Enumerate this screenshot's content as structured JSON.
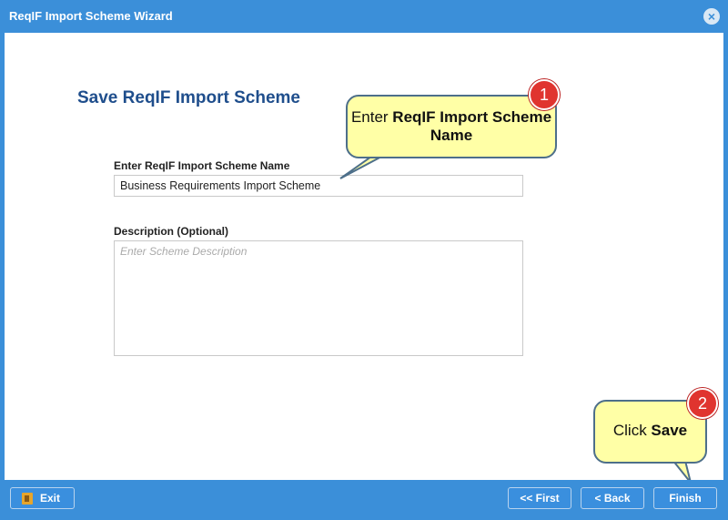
{
  "window": {
    "title": "ReqIF Import Scheme Wizard",
    "close_icon": "×"
  },
  "page": {
    "heading": "Save ReqIF Import Scheme"
  },
  "form": {
    "name_label": "Enter ReqIF Import Scheme Name",
    "name_value": "Business Requirements Import Scheme",
    "description_label": "Description (Optional)",
    "description_placeholder": "Enter Scheme Description"
  },
  "callouts": [
    {
      "number": "1",
      "prefix": "Enter ",
      "bold": "ReqIF Import Scheme Name"
    },
    {
      "number": "2",
      "prefix": "Click ",
      "bold": "Save"
    }
  ],
  "footer": {
    "exit_label": "Exit",
    "first_label": "<< First",
    "back_label": "< Back",
    "finish_label": "Finish"
  },
  "colors": {
    "accent": "#3b8fd9",
    "heading": "#1f4e8c",
    "callout_bg": "#ffffa6",
    "badge": "#e0342f"
  }
}
